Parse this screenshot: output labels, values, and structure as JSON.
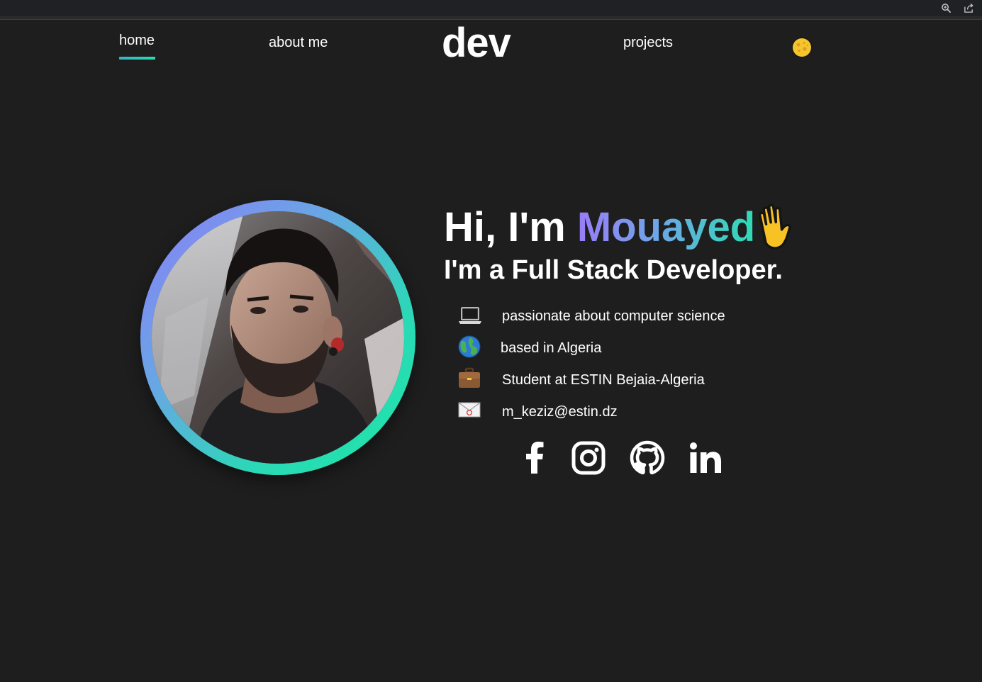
{
  "browser": {
    "icons": [
      "zoom-in-icon",
      "share-icon"
    ]
  },
  "nav": {
    "home": "home",
    "about": "about me",
    "logo": "dev",
    "projects": "projects",
    "theme_toggle_icon": "moon-icon"
  },
  "hero": {
    "greeting_prefix": "Hi, I'm ",
    "name": "Mouayed",
    "wave_icon": "waving-hand-icon",
    "subtitle": "I'm a Full Stack Developer.",
    "info": [
      {
        "icon": "laptop-icon",
        "text": "passionate about computer science"
      },
      {
        "icon": "globe-icon",
        "text": "based in Algeria"
      },
      {
        "icon": "briefcase-icon",
        "text": "Student at ESTIN Bejaia-Algeria"
      },
      {
        "icon": "email-icon",
        "text": "m_keziz@estin.dz"
      }
    ],
    "socials": [
      "facebook-icon",
      "instagram-icon",
      "github-icon",
      "linkedin-icon"
    ]
  },
  "colors": {
    "background": "#1e1e1f",
    "accent_start": "#9a7cf7",
    "accent_end": "#1ee6a6",
    "nav_underline": "#22e0a8"
  }
}
